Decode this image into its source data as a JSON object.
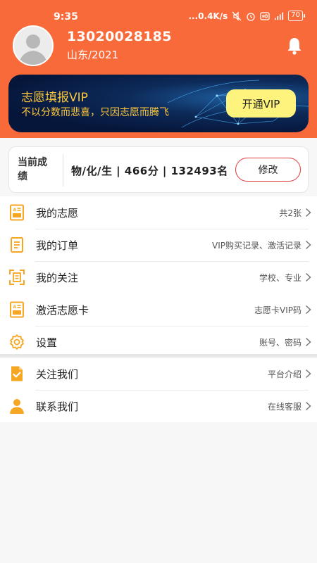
{
  "status": {
    "time": "9:35",
    "network": "...0.4K/s",
    "battery": "70"
  },
  "user": {
    "phone": "13020028185",
    "region_year": "山东/2021"
  },
  "banner": {
    "title": "志愿填报VIP",
    "subtitle": "不以分数而悲喜，只因志愿而腾飞",
    "button_label": "开通VIP"
  },
  "score": {
    "label": "当前成绩",
    "value": "物/化/生 | 466分 | 132493名",
    "edit_label": "修改"
  },
  "menu_groups": [
    [
      {
        "label": "我的志愿",
        "hint": "共2张",
        "icon": "volunteer-form-icon"
      },
      {
        "label": "我的订单",
        "hint": "VIP购买记录、激活记录",
        "icon": "order-document-icon"
      },
      {
        "label": "我的关注",
        "hint": "学校、专业",
        "icon": "follow-frame-icon"
      }
    ],
    [
      {
        "label": "激活志愿卡",
        "hint": "志愿卡VIP码",
        "icon": "activation-card-icon"
      },
      {
        "label": "设置",
        "hint": "账号、密码",
        "icon": "gear-icon"
      }
    ],
    [
      {
        "label": "关注我们",
        "hint": "平台介绍",
        "icon": "checked-document-icon"
      },
      {
        "label": "联系我们",
        "hint": "在线客服",
        "icon": "person-icon"
      }
    ]
  ],
  "colors": {
    "header": "#f86a3a",
    "accent_icon": "#f5a623",
    "vip_text": "#ffc83a",
    "vip_button": "#fdf37d",
    "edit_border": "#e03838"
  }
}
